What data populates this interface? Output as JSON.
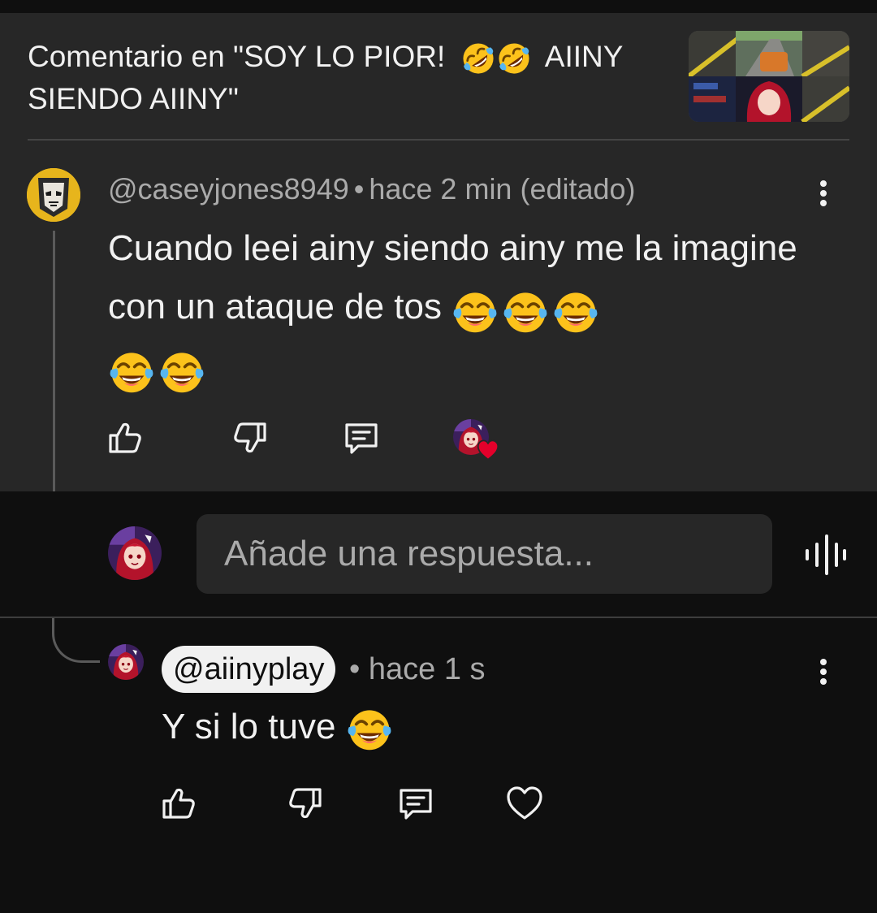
{
  "header": {
    "title_prefix": "Comentario en \"SOY LO PIOR!",
    "title_emojis": [
      "rolling-on-floor-laughing",
      "rolling-on-floor-laughing"
    ],
    "title_suffix": "AIINY SIENDO AIINY\""
  },
  "comment": {
    "author": "@caseyjones8949",
    "separator": "•",
    "time": "hace 2 min (editado)",
    "text": "Cuando leei ainy siendo ainy me la imagine con un ataque de tos",
    "emojis": [
      "face-with-tears-of-joy",
      "face-with-tears-of-joy",
      "face-with-tears-of-joy",
      "face-with-tears-of-joy",
      "face-with-tears-of-joy"
    ],
    "actions": [
      "like-icon",
      "dislike-icon",
      "reply-icon",
      "creator-heart"
    ]
  },
  "reply_box": {
    "placeholder": "Añade una respuesta...",
    "voice_icon": "voice-search-icon"
  },
  "reply": {
    "author": "@aiinyplay",
    "separator": "•",
    "time": "hace 1 s",
    "text": "Y si lo tuve",
    "emojis": [
      "face-with-tears-of-joy"
    ],
    "actions": [
      "like-icon",
      "dislike-icon",
      "reply-icon",
      "heart-icon"
    ]
  },
  "colors": {
    "card_bg": "#272727",
    "page_bg": "#0f0f0f",
    "text_primary": "#f1f1f1",
    "text_secondary": "#aaaaaa",
    "heart_red": "#e4002b"
  }
}
